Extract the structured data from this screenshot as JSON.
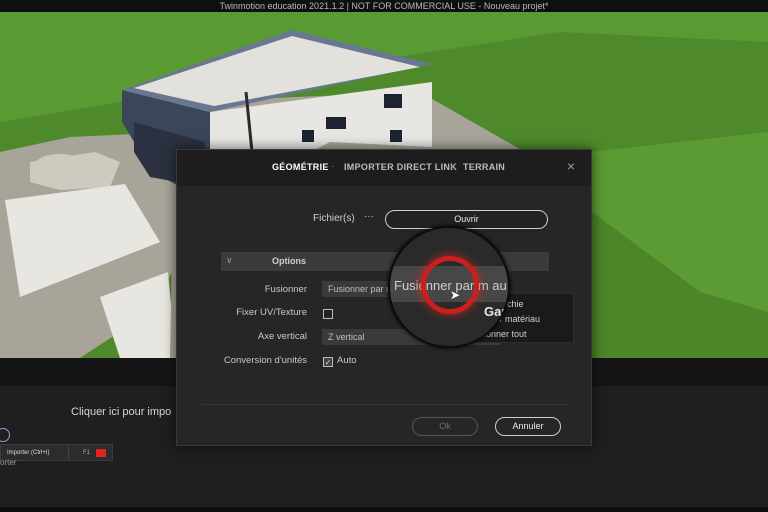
{
  "window": {
    "title": "Twinmotion education 2021.1.2 | NOT FOR COMMERCIAL USE - Nouveau projet*"
  },
  "modal": {
    "tabs": [
      "GÉOMÉTRIE",
      "IMPORTER DIRECT LINK",
      "TERRAIN"
    ],
    "tab_separator": "·",
    "active_tab": "GÉOMÉTRIE",
    "close_icon": "×",
    "files_label": "Fichier(s)",
    "files_browse": "···",
    "open_button": "Ouvrir",
    "options_section": "Options",
    "options_chevron": "∨",
    "fields": {
      "merge_label": "Fusionner",
      "merge_value": "Fusionner par m",
      "fix_uv_label": "Fixer UV/Texture",
      "axis_label": "Axe vertical",
      "axis_value": "Z vertical",
      "unit_label": "Conversion d'unités",
      "unit_value": "Auto",
      "unit_checked": true,
      "fix_uv_checked": false
    },
    "ok_button": "Ok",
    "cancel_button": "Annuler"
  },
  "dropdown": {
    "items": [
      "hiérarchie",
      "r par matériau",
      "ionner tout"
    ]
  },
  "lens": {
    "magnified_text": "Fusionner par m  au",
    "magnified_partial": "Gar"
  },
  "dock": {
    "hint": "Cliquer ici pour impo",
    "importer_button": "Importer (Ctrl+I)",
    "importer_shortcut": "F1",
    "caption": "orter"
  },
  "colors": {
    "accent_red": "#e02424",
    "lens_ring": "#c9201e",
    "grass": "#4f8a2a"
  }
}
